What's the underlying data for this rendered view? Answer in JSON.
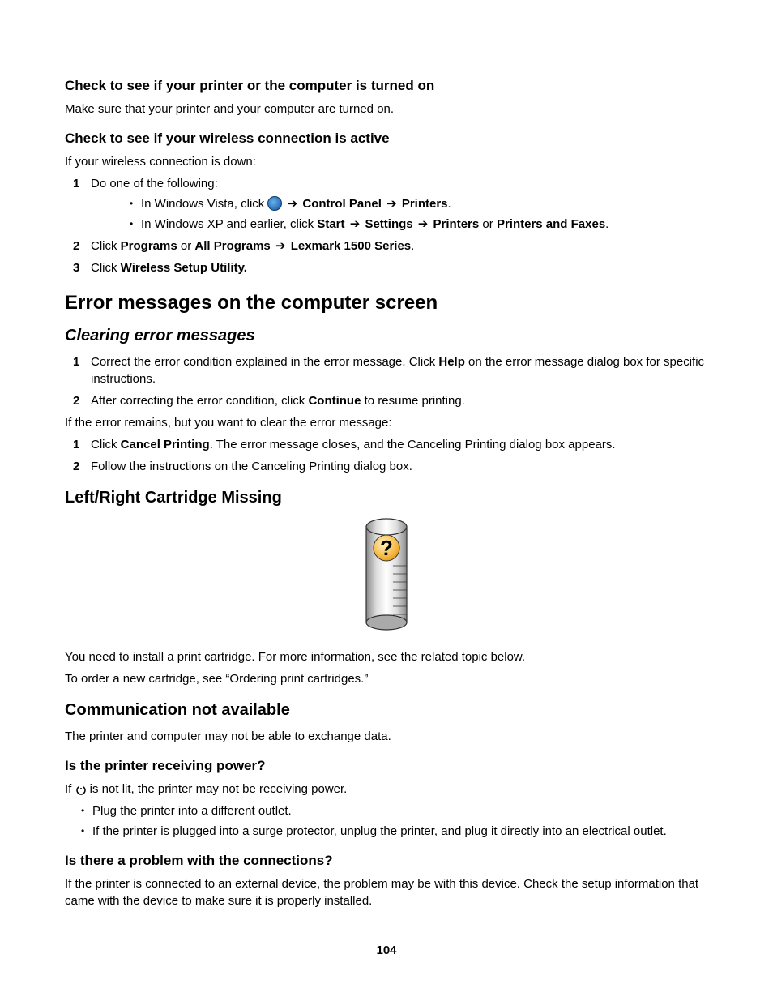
{
  "pageNumber": "104",
  "sec1": {
    "h": "Check to see if your printer or the computer is turned on",
    "p": "Make sure that your printer and your computer are turned on."
  },
  "sec2": {
    "h": "Check to see if your wireless connection is active",
    "p": "If your wireless connection is down:",
    "step1": "Do one of the following:",
    "bul1a": "In Windows Vista, click ",
    "bul1b_cp": "Control Panel",
    "bul1b_pr": "Printers",
    "bul2a": "In Windows XP and earlier, click ",
    "bul2_start": "Start",
    "bul2_settings": "Settings",
    "bul2_printers": "Printers",
    "bul2_or": " or ",
    "bul2_faxes": "Printers and Faxes",
    "step2a": "Click ",
    "step2_programs": "Programs",
    "step2_or": " or ",
    "step2_allprograms": "All Programs",
    "step2_lexmark": "Lexmark 1500 Series",
    "step3a": "Click ",
    "step3b": "Wireless Setup Utility."
  },
  "sec3": {
    "h": "Error messages on the computer screen",
    "sub": "Clearing error messages",
    "step1a": "Correct the error condition explained in the error message. Click ",
    "step1_help": "Help",
    "step1b": " on the error message dialog box for specific instructions.",
    "step2a": "After correcting the error condition, click ",
    "step2_cont": "Continue",
    "step2b": " to resume printing.",
    "p2": "If the error remains, but you want to clear the error message:",
    "step3a": "Click ",
    "step3_cancel": "Cancel Printing",
    "step3b": ". The error message closes, and the Canceling Printing dialog box appears.",
    "step4": "Follow the instructions on the Canceling Printing dialog box."
  },
  "sec4": {
    "h": "Left/Right Cartridge Missing",
    "p1": "You need to install a print cartridge. For more information, see the related topic below.",
    "p2": "To order a new cartridge, see “Ordering print cartridges.”"
  },
  "sec5": {
    "h": "Communication not available",
    "p": "The printer and computer may not be able to exchange data.",
    "sub1": "Is the printer receiving power?",
    "s1_p_a": "If ",
    "s1_p_b": " is not lit, the printer may not be receiving power.",
    "b1": "Plug the printer into a different outlet.",
    "b2": "If the printer is plugged into a surge protector, unplug the printer, and plug it directly into an electrical outlet.",
    "sub2": "Is there a problem with the connections?",
    "s2_p": "If the printer is connected to an external device, the problem may be with this device. Check the setup information that came with the device to make sure it is properly installed."
  },
  "arrow": "➔",
  "period": "."
}
